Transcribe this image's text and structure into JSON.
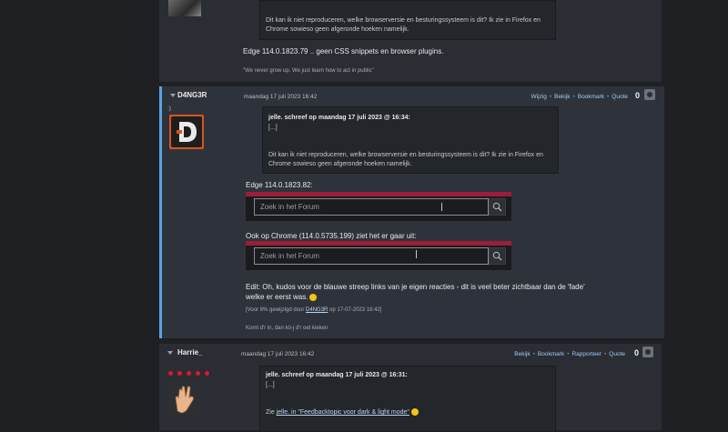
{
  "post_prev": {
    "quote_line1": "Dit kan ik niet reproduceren, welke browserversie en besturingssysteem is dit? Ik zie in Firefox en",
    "quote_line2": "Chrome sowieso geen afgeronde hoeken namelijk.",
    "body": "Edge 114.0.1823.79 .. geen CSS snippets en browser plugins.",
    "signature": "\"We never grow up. We just learn how to act in public\""
  },
  "post_main": {
    "username": "D4NG3R",
    "status": ":)",
    "date": "maandag 17 juli 2023 16:42",
    "actions": [
      "Wijzig",
      "Bekijk",
      "Bookmark",
      "Quote"
    ],
    "score": "0",
    "quote_header": "jelle. schreef op maandag 17 juli 2023 @ 16:34:",
    "quote_ellipsis": "[...]",
    "quote_line1": "Dit kan ik niet reproduceren, welke browserversie en besturingssysteem is dit? Ik zie in Firefox en",
    "quote_line2": "Chrome sowieso geen afgeronde hoeken namelijk.",
    "edge_label": "Edge 114.0.1823.82:",
    "search_placeholder_1": "Zoek in het Forum",
    "chrome_label": "Ook op Chrome (114.0.5735.199) ziet het er gaar uit:",
    "search_placeholder_2": "Zoek in het Forum",
    "edit_line1": "Edit: Oh, kudos voor de blauwe streep links van je eigen reacties - dit is veel beter zichtbaar dan de 'fade'",
    "edit_line2": "welke er eerst was.",
    "edited_note_prefix": "[Voor 8% gewijzigd door ",
    "edited_note_user": "D4NG3R",
    "edited_note_suffix": " op 17-07-2023 16:42]",
    "signature": "Komt d'r in, dan kö-j d'r oet kieken"
  },
  "post_next": {
    "username": "Harrie_",
    "date": "maandag 17 juli 2023 16:42",
    "actions": [
      "Bekijk",
      "Bookmark",
      "Rapporteer",
      "Quote"
    ],
    "score": "0",
    "quote_header": "jelle. schreef op maandag 17 juli 2023 @ 16:31:",
    "quote_ellipsis": "[...]",
    "body_prefix": "Zie ",
    "body_link": "jelle. in \"Feedbacktopic voor dark & light mode\""
  },
  "colors": {
    "own_post_border": "#5aa3e6",
    "search_bar_accent": "#9a1e38",
    "link": "#9ecbf2",
    "rank_dot": "#e0162b"
  }
}
